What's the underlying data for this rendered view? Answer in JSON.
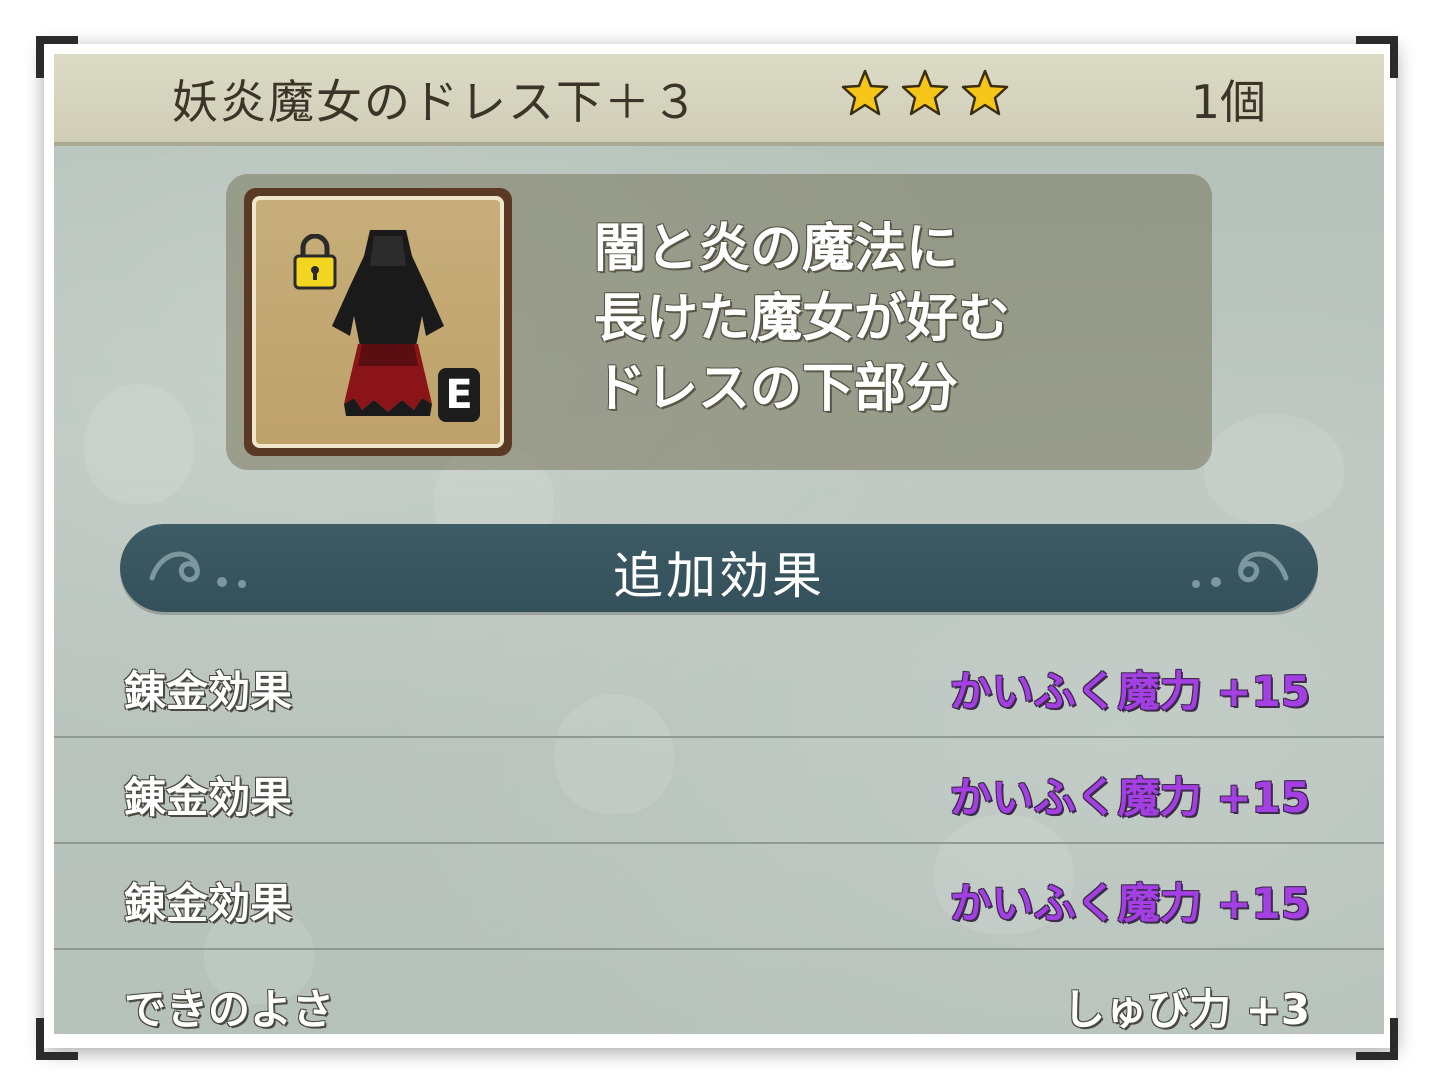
{
  "header": {
    "title": "妖炎魔女のドレス下＋３",
    "stars": 3,
    "count": "1個"
  },
  "item": {
    "icon": "witch-dress-bottom-icon",
    "locked": true,
    "equipped_badge": "E"
  },
  "description": {
    "lines": [
      "闇と炎の魔法に",
      "長けた魔女が好む",
      "ドレスの下部分"
    ]
  },
  "effects": {
    "title": "追加効果",
    "rows": [
      {
        "label": "錬金効果",
        "value": "かいふく魔力 +15",
        "style": "purple"
      },
      {
        "label": "錬金効果",
        "value": "かいふく魔力 +15",
        "style": "purple"
      },
      {
        "label": "錬金効果",
        "value": "かいふく魔力 +15",
        "style": "purple"
      },
      {
        "label": "できのよさ",
        "value": "しゅび力 +3",
        "style": "white"
      }
    ]
  },
  "colors": {
    "accent_purple": "#a33fe3",
    "banner": "#3e5c66",
    "header_bg": "#dcdbc6"
  }
}
